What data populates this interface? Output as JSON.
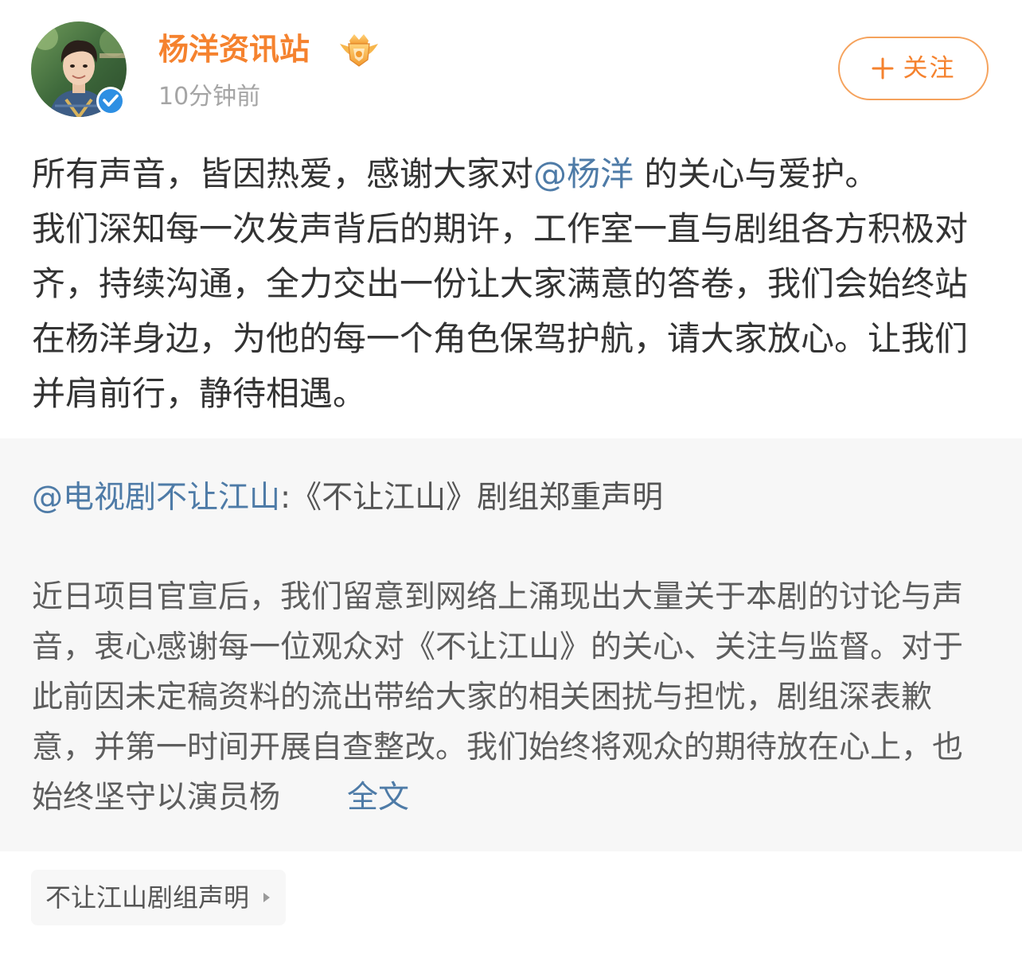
{
  "header": {
    "username": "杨洋资讯站",
    "time": "10分钟前",
    "follow_label": "关注",
    "icons": {
      "avatar": "profile-photo",
      "verified": "verified-badge-icon",
      "member": "crown-badge-icon",
      "follow": "plus-icon"
    }
  },
  "post": {
    "line1_before": "所有声音，皆因热爱，感谢大家对",
    "mention": "@杨洋",
    "line1_after": " 的关心与爱护。",
    "rest": "我们深知每一次发声背后的期许，工作室一直与剧组各方积极对齐，持续沟通，全力交出一份让大家满意的答卷，我们会始终站在杨洋身边，为他的每一个角色保驾护航，请大家放心。让我们并肩前行，静待相遇。"
  },
  "repost": {
    "author": "@电视剧不让江山",
    "colon": ":",
    "title": "《不让江山》剧组郑重声明",
    "body": "近日项目官宣后，我们留意到网络上涌现出大量关于本剧的讨论与声音，衷心感谢每一位观众对《不让江山》的关心、关注与监督。对于此前因未定稿资料的流出带给大家的相关困扰与担忧，剧组深表歉意，并第一时间开展自查整改。我们始终将观众的期待放在心上，也始终坚守以演员杨",
    "more_label": "全文"
  },
  "topic": {
    "label": "不让江山剧组声明",
    "icon": "chevron-right-icon"
  },
  "colors": {
    "accent_orange": "#f5822e",
    "link_blue": "#4e7ba7",
    "verified_blue": "#2d8fe3",
    "quote_background": "#f7f7f7",
    "muted_text": "#a5a5a5"
  }
}
